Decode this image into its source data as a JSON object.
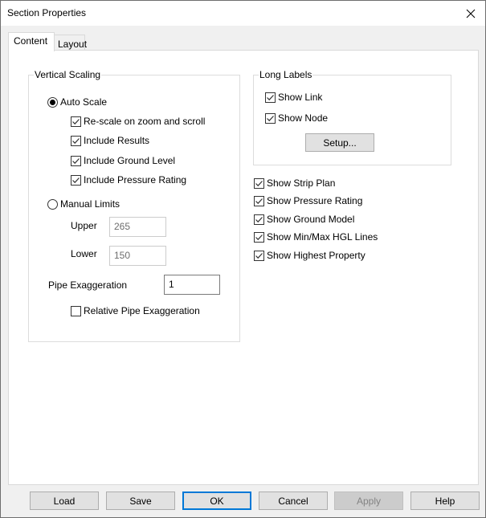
{
  "window": {
    "title": "Section Properties",
    "close_icon": "close-x-icon"
  },
  "tabs": [
    {
      "label": "Content",
      "active": true
    },
    {
      "label": "Layout",
      "active": false
    }
  ],
  "vertical_scaling": {
    "legend": "Vertical Scaling",
    "auto_scale": {
      "label": "Auto Scale",
      "selected": true
    },
    "auto_options": [
      {
        "label": "Re-scale on zoom and scroll",
        "checked": true
      },
      {
        "label": "Include Results",
        "checked": true
      },
      {
        "label": "Include Ground Level",
        "checked": true
      },
      {
        "label": "Include Pressure Rating",
        "checked": true
      }
    ],
    "manual_limits": {
      "label": "Manual Limits",
      "selected": false
    },
    "upper": {
      "label": "Upper",
      "value": "265",
      "enabled": false
    },
    "lower": {
      "label": "Lower",
      "value": "150",
      "enabled": false
    },
    "pipe_exaggeration": {
      "label": "Pipe Exaggeration",
      "value": "1"
    },
    "relative_pipe_exaggeration": {
      "label": "Relative Pipe Exaggeration",
      "checked": false
    }
  },
  "long_labels": {
    "legend": "Long Labels",
    "show_link": {
      "label": "Show Link",
      "checked": true
    },
    "show_node": {
      "label": "Show Node",
      "checked": true
    },
    "setup_button": "Setup..."
  },
  "display_options": [
    {
      "label": "Show Strip Plan",
      "checked": true
    },
    {
      "label": "Show Pressure Rating",
      "checked": true
    },
    {
      "label": "Show Ground Model",
      "checked": true
    },
    {
      "label": "Show Min/Max HGL Lines",
      "checked": true
    },
    {
      "label": "Show Highest Property",
      "checked": true
    }
  ],
  "footer": {
    "load": "Load",
    "save": "Save",
    "ok": "OK",
    "cancel": "Cancel",
    "apply": "Apply",
    "help": "Help"
  },
  "colors": {
    "accent": "#0078d7",
    "dialog_bg": "#f0f0f0",
    "panel_bg": "#ffffff",
    "disabled_text": "#838383"
  }
}
